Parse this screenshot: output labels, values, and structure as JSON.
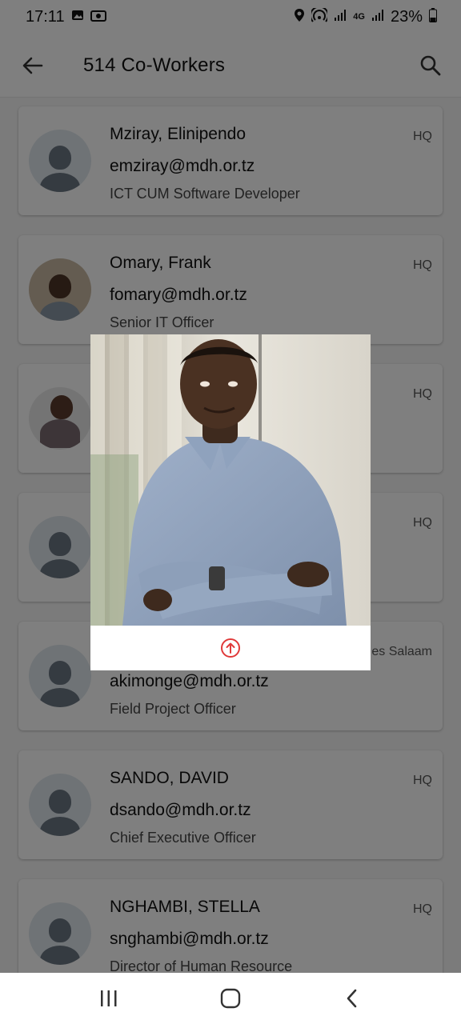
{
  "status_bar": {
    "time": "17:11",
    "battery": "23%",
    "icons": [
      "image-icon",
      "photo-icon",
      "location-icon",
      "hotspot-icon",
      "signal-icon",
      "4g-icon",
      "signal-icon",
      "battery-icon"
    ]
  },
  "appbar": {
    "title": "514 Co-Workers",
    "back_icon": "back-arrow-icon",
    "search_icon": "search-icon"
  },
  "coworkers": [
    {
      "name": "Mziray, Elinipendo",
      "email": "emziray@mdh.or.tz",
      "role": "ICT CUM Software Developer",
      "office": "HQ",
      "avatar": "placeholder"
    },
    {
      "name": "Omary, Frank",
      "email": "fomary@mdh.or.tz",
      "role": "Senior IT Officer",
      "office": "HQ",
      "avatar": "photo"
    },
    {
      "name": "",
      "email": "",
      "role": "",
      "office": "HQ",
      "avatar": "photo"
    },
    {
      "name": "",
      "email": "",
      "role": "",
      "office": "HQ",
      "avatar": "placeholder"
    },
    {
      "name": "",
      "email": "akimonge@mdh.or.tz",
      "role": "Field Project Officer",
      "office": "es Salaam",
      "avatar": "placeholder"
    },
    {
      "name": "SANDO, DAVID",
      "email": "dsando@mdh.or.tz",
      "role": "Chief Executive Officer",
      "office": "HQ",
      "avatar": "placeholder"
    },
    {
      "name": "NGHAMBI, STELLA",
      "email": "snghambi@mdh.or.tz",
      "role": "Director of Human Resource",
      "office": "HQ",
      "avatar": "placeholder"
    }
  ],
  "dialog": {
    "photo_alt": "profile-photo",
    "upload_icon": "upload-icon",
    "accent": "#e03a3a"
  },
  "nav": {
    "recents_icon": "recents-icon",
    "home_icon": "home-icon",
    "back_icon": "nav-back-icon"
  }
}
